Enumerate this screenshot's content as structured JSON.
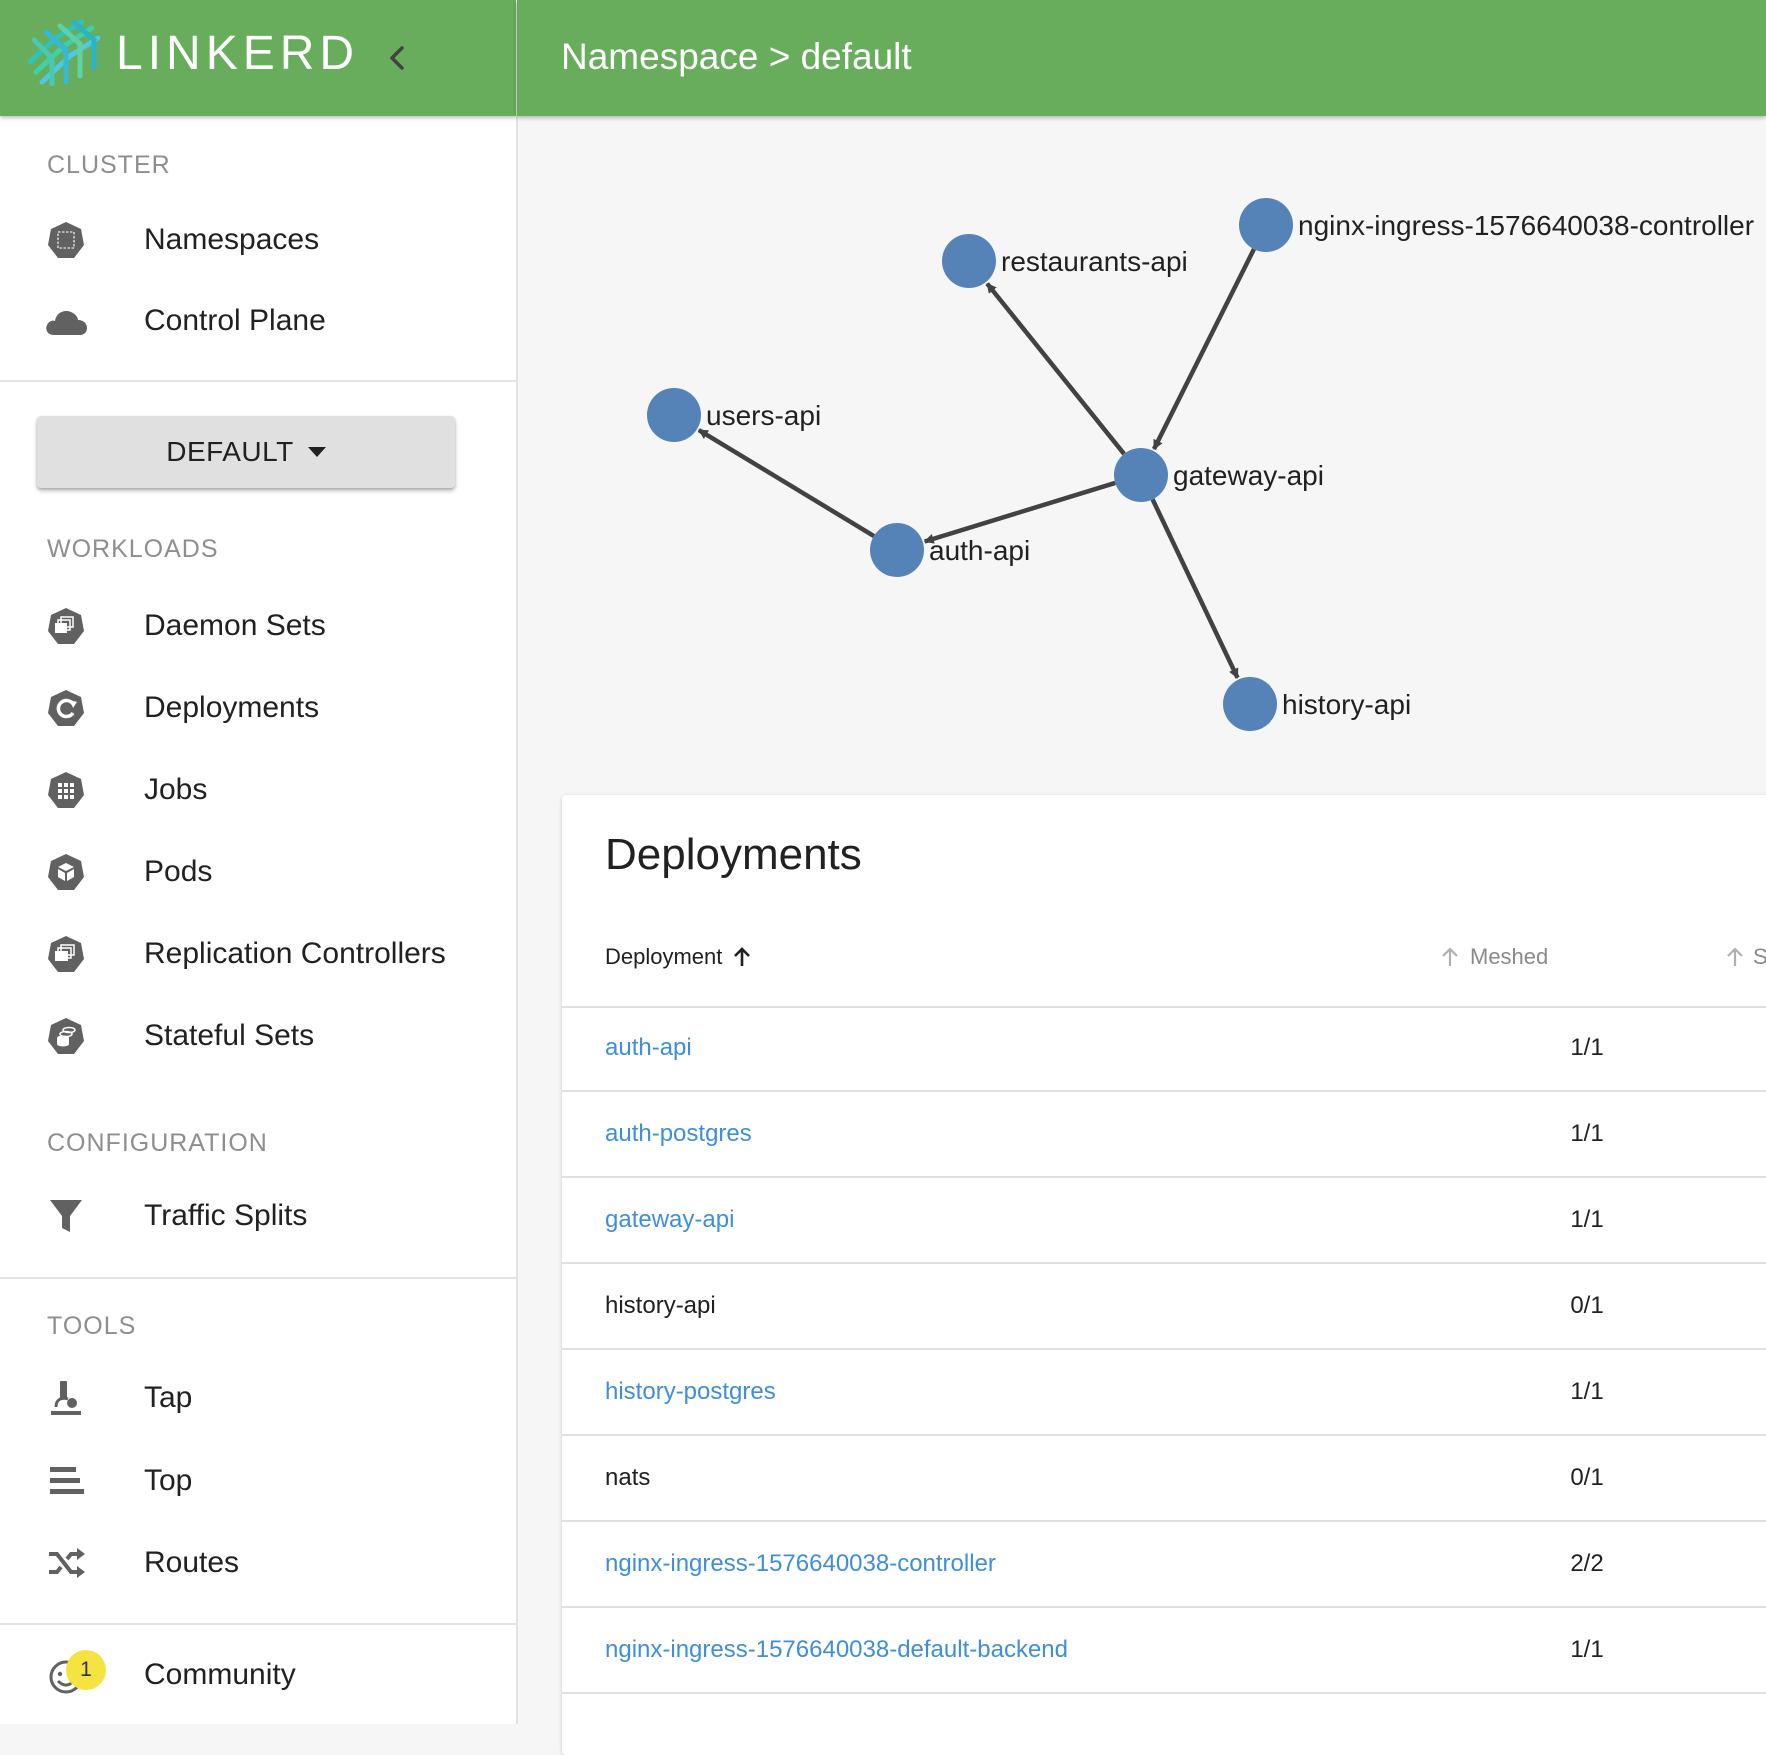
{
  "brand": {
    "name": "LINKERD"
  },
  "header": {
    "title": "Namespace > default"
  },
  "sidebar": {
    "sections": {
      "cluster": "CLUSTER",
      "workloads": "WORKLOADS",
      "configuration": "CONFIGURATION",
      "tools": "TOOLS"
    },
    "cluster_items": [
      {
        "label": "Namespaces",
        "icon": "namespace-icon"
      },
      {
        "label": "Control Plane",
        "icon": "cloud-icon"
      }
    ],
    "namespace_selector": {
      "value": "DEFAULT"
    },
    "workload_items": [
      {
        "label": "Daemon Sets",
        "icon": "daemon-set-icon"
      },
      {
        "label": "Deployments",
        "icon": "deployment-icon"
      },
      {
        "label": "Jobs",
        "icon": "job-icon"
      },
      {
        "label": "Pods",
        "icon": "pod-icon"
      },
      {
        "label": "Replication Controllers",
        "icon": "replication-controller-icon"
      },
      {
        "label": "Stateful Sets",
        "icon": "stateful-set-icon"
      }
    ],
    "configuration_items": [
      {
        "label": "Traffic Splits",
        "icon": "filter-icon"
      }
    ],
    "tool_items": [
      {
        "label": "Tap",
        "icon": "microscope-icon"
      },
      {
        "label": "Top",
        "icon": "list-icon"
      },
      {
        "label": "Routes",
        "icon": "shuffle-icon"
      }
    ],
    "community": {
      "label": "Community",
      "icon": "smiley-icon",
      "badge": "1"
    }
  },
  "graph": {
    "nodes": [
      {
        "id": "restaurants-api",
        "label": "restaurants-api"
      },
      {
        "id": "nginx",
        "label": "nginx-ingress-1576640038-controller"
      },
      {
        "id": "users-api",
        "label": "users-api"
      },
      {
        "id": "gateway-api",
        "label": "gateway-api"
      },
      {
        "id": "auth-api",
        "label": "auth-api"
      },
      {
        "id": "history-api",
        "label": "history-api"
      }
    ],
    "edges": [
      {
        "from": "nginx",
        "to": "gateway-api"
      },
      {
        "from": "gateway-api",
        "to": "restaurants-api"
      },
      {
        "from": "gateway-api",
        "to": "auth-api"
      },
      {
        "from": "auth-api",
        "to": "users-api"
      },
      {
        "from": "gateway-api",
        "to": "history-api"
      }
    ],
    "colors": {
      "node": "#5583b7",
      "edge": "#424242"
    }
  },
  "table": {
    "title": "Deployments",
    "columns": {
      "deployment": "Deployment",
      "meshed": "Meshed",
      "third": "S"
    },
    "rows": [
      {
        "name": "auth-api",
        "meshed": "1/1",
        "link": true
      },
      {
        "name": "auth-postgres",
        "meshed": "1/1",
        "link": true
      },
      {
        "name": "gateway-api",
        "meshed": "1/1",
        "link": true
      },
      {
        "name": "history-api",
        "meshed": "0/1",
        "link": false
      },
      {
        "name": "history-postgres",
        "meshed": "1/1",
        "link": true
      },
      {
        "name": "nats",
        "meshed": "0/1",
        "link": false
      },
      {
        "name": "nginx-ingress-1576640038-controller",
        "meshed": "2/2",
        "link": true
      },
      {
        "name": "nginx-ingress-1576640038-default-backend",
        "meshed": "1/1",
        "link": true
      }
    ]
  },
  "colors": {
    "header_green": "#67ad5b",
    "link_blue": "#3f8edb",
    "section_gray": "#8e8e8e",
    "badge_yellow": "#f5e342"
  }
}
